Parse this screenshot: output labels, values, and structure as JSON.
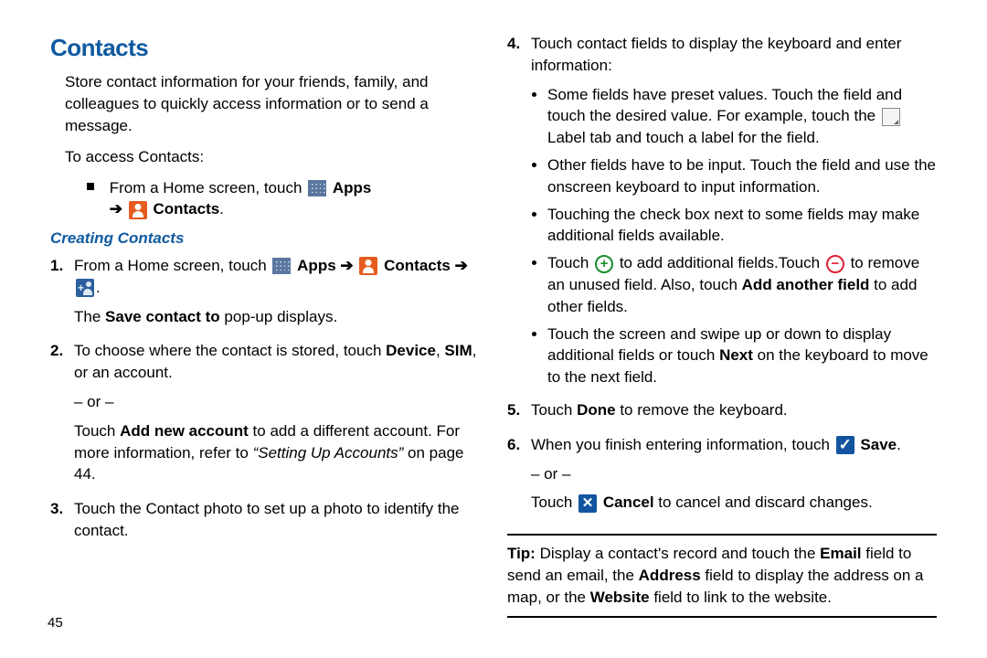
{
  "title": "Contacts",
  "intro": "Store contact information for your friends, family, and colleagues to quickly access information or to send a message.",
  "access_label": "To access Contacts:",
  "access_line": {
    "pre": "From a Home screen, touch ",
    "apps": "Apps",
    "arrow": "➔",
    "contacts": "Contacts",
    "period": "."
  },
  "subhead": "Creating Contacts",
  "step1": {
    "num": "1.",
    "pre": "From a Home screen, touch ",
    "apps": "Apps",
    "arrow1": "➔",
    "contacts": "Contacts",
    "arrow2": "➔",
    "period": ".",
    "popup": "The Save contact to pop-up displays."
  },
  "step2": {
    "num": "2.",
    "line1_a": "To choose where the contact is stored, touch ",
    "line1_b_device": "Device",
    "line1_c": ", ",
    "line1_d_sim": "SIM",
    "line1_e": ", or an account.",
    "or": "– or –",
    "line2_a": "Touch ",
    "line2_b_add": "Add new account",
    "line2_c": " to add a different account. For more information, refer to ",
    "line2_ref": "“Setting Up Accounts”",
    "line2_d": " on page 44."
  },
  "step3": {
    "num": "3.",
    "text": "Touch the Contact photo to set up a photo to identify the contact."
  },
  "step4": {
    "num": "4.",
    "lead": "Touch contact fields to display the keyboard and enter information:",
    "b1_a": "Some fields have preset values. Touch the field and touch the desired value. For example, touch the ",
    "b1_b": " Label tab and touch a label for the field.",
    "b2": "Other fields have to be input. Touch the field and use the onscreen keyboard to input information.",
    "b3": "Touching the check box next to some fields may make additional fields available.",
    "b4_a": "Touch ",
    "b4_b": " to add additional fields.Touch ",
    "b4_c": " to remove an unused field. Also, touch ",
    "b4_add_another": "Add another field",
    "b4_d": " to add other fields.",
    "b5_a": "Touch the screen and swipe up or down to display additional fields or touch ",
    "b5_next": "Next",
    "b5_b": " on the keyboard to move to the next field."
  },
  "step5": {
    "num": "5.",
    "a": "Touch ",
    "done": "Done",
    "b": " to remove the keyboard."
  },
  "step6": {
    "num": "6.",
    "a": "When you finish entering information, touch ",
    "save": "Save",
    "period": ".",
    "or": "– or –",
    "cancel_a": "Touch ",
    "cancel_label": "Cancel",
    "cancel_b": " to cancel and discard changes."
  },
  "tip": {
    "label": "Tip:",
    "a": " Display a contact's record and touch the ",
    "email": "Email",
    "b": " field to send an email, the ",
    "address": "Address",
    "c": " field to display the address on a map, or the ",
    "website": "Website",
    "d": " field to link to the website."
  },
  "page": "45"
}
